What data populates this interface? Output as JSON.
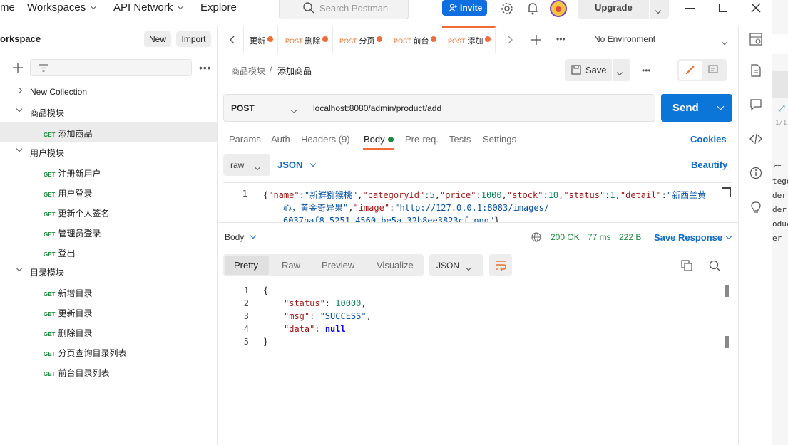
{
  "topbar": {
    "nav": [
      {
        "label": "me"
      },
      {
        "label": "Workspaces"
      },
      {
        "label": "API Network"
      },
      {
        "label": "Explore"
      }
    ],
    "search_placeholder": "Search Postman",
    "invite_label": "Invite",
    "upgrade_label": "Upgrade"
  },
  "sidebar": {
    "workspace_title": "orkspace",
    "new_label": "New",
    "import_label": "Import",
    "tree": [
      {
        "label": "New Collection"
      },
      {
        "label": "商品模块"
      },
      {
        "method": "GET",
        "label": "添加商品"
      },
      {
        "label": "用户模块"
      },
      {
        "method": "GET",
        "label": "注册新用户"
      },
      {
        "method": "GET",
        "label": "用户登录"
      },
      {
        "method": "GET",
        "label": "更新个人签名"
      },
      {
        "method": "GET",
        "label": "管理员登录"
      },
      {
        "method": "GET",
        "label": "登出"
      },
      {
        "label": "目录模块"
      },
      {
        "method": "GET",
        "label": "新增目录"
      },
      {
        "method": "GET",
        "label": "更新目录"
      },
      {
        "method": "GET",
        "label": "删除目录"
      },
      {
        "method": "GET",
        "label": "分页查询目录列表"
      },
      {
        "method": "GET",
        "label": "前台目录列表"
      }
    ]
  },
  "tabs": [
    {
      "method": "",
      "label": "更新"
    },
    {
      "method": "POST",
      "label": "删除"
    },
    {
      "method": "POST",
      "label": "分页"
    },
    {
      "method": "POST",
      "label": "前台"
    },
    {
      "method": "POST",
      "label": "添加"
    }
  ],
  "environment": "No Environment",
  "breadcrumb": {
    "parent": "商品模块",
    "separator": "/",
    "current": "添加商品"
  },
  "save_label": "Save",
  "request": {
    "method": "POST",
    "url": "localhost:8080/admin/product/add",
    "send_label": "Send"
  },
  "req_tabs": {
    "params": "Params",
    "auth": "Auth",
    "headers": "Headers (9)",
    "body": "Body",
    "prereq": "Pre-req.",
    "tests": "Tests",
    "settings": "Settings",
    "cookies": "Cookies"
  },
  "body_mode": {
    "raw": "raw",
    "json": "JSON",
    "beautify": "Beautify"
  },
  "req_body": {
    "line_no": "1",
    "parts": [
      "{",
      "\"name\"",
      ":",
      "\"新鲜猕猴桃\"",
      ",",
      "\"categoryId\"",
      ":",
      "5",
      ",",
      "\"price\"",
      ":",
      "1000",
      ",",
      "\"stock\"",
      ":",
      "10",
      ",",
      "\"status\"",
      ":",
      "1",
      ",",
      "\"detail\"",
      ":",
      "\"新西兰黄",
      "心，黄金奇异果\"",
      ",",
      "\"image\"",
      ":",
      "\"http://127.0.0.1:8083/images/",
      "6037baf8-5251-4560-be5a-32b8ee3823cf.png\"",
      "}"
    ]
  },
  "response": {
    "body_label": "Body",
    "status": "200 OK",
    "time": "77 ms",
    "size": "222 B",
    "save_response": "Save Response",
    "view_tabs": [
      "Pretty",
      "Raw",
      "Preview",
      "Visualize"
    ],
    "format": "JSON",
    "lines": [
      {
        "n": "1",
        "text": "{"
      },
      {
        "n": "2",
        "key": "\"status\"",
        "val": "10000",
        "vtype": "n",
        "comma": ","
      },
      {
        "n": "3",
        "key": "\"msg\"",
        "val": "\"SUCCESS\"",
        "vtype": "s",
        "comma": ","
      },
      {
        "n": "4",
        "key": "\"data\"",
        "val": "null",
        "vtype": "kw",
        "comma": ""
      },
      {
        "n": "5",
        "text": "}"
      }
    ]
  },
  "strip_text": [
    "rt",
    "tego",
    "der",
    "der_",
    "oduc",
    "er"
  ],
  "strip_small": "1/1",
  "colors": {
    "accent_blue": "#0f6fe0",
    "send_blue": "#0c75d8",
    "post_orange": "#e8702a",
    "get_green": "#1f8a3e",
    "status_green": "#1f8a3e",
    "unsaved_dot": "#f26b3a"
  }
}
